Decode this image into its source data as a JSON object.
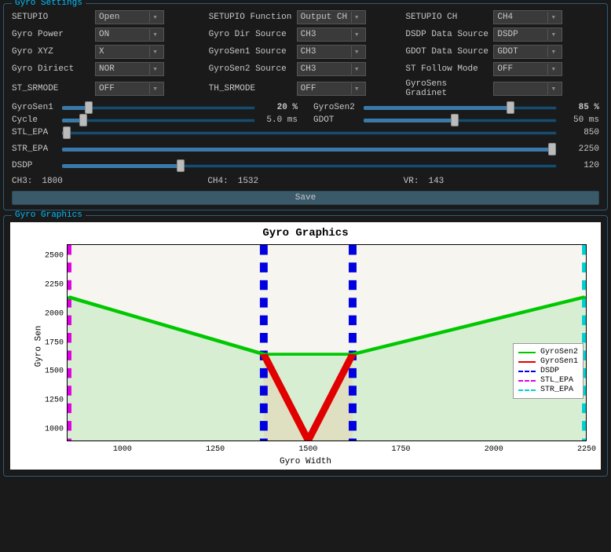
{
  "settings": {
    "title": "Gyro Settings",
    "rows": [
      {
        "l1": "SETUPIO",
        "v1": "Open",
        "l2": "SETUPIO Function",
        "v2": "Output CH",
        "l3": "SETUPIO CH",
        "v3": "CH4"
      },
      {
        "l1": "Gyro Power",
        "v1": "ON",
        "l2": "Gyro Dir Source",
        "v2": "CH3",
        "l3": "DSDP Data Source",
        "v3": "DSDP"
      },
      {
        "l1": "Gyro XYZ",
        "v1": "X",
        "l2": "GyroSen1 Source",
        "v2": "CH3",
        "l3": "GDOT Data Source",
        "v3": "GDOT"
      },
      {
        "l1": "Gyro Diriect",
        "v1": "NOR",
        "l2": "GyroSen2 Source",
        "v2": "CH3",
        "l3": "ST Follow Mode",
        "v3": "OFF"
      },
      {
        "l1": "ST_SRMODE",
        "v1": "OFF",
        "l2": "TH_SRMODE",
        "v2": "OFF",
        "l3": "GyroSens Gradinet",
        "v3": ""
      }
    ],
    "sliders_pair": {
      "a": {
        "label": "GyroSen1",
        "value": "20 %",
        "pct": 14
      },
      "b": {
        "label": "GyroSen2",
        "value": "85 %",
        "pct": 76
      }
    },
    "sliders_pair2": {
      "a": {
        "label": "Cycle",
        "value": "5.0 ms",
        "pct": 11
      },
      "b": {
        "label": "GDOT",
        "value": "50 ms",
        "pct": 47
      }
    },
    "sliders_full": [
      {
        "label": "STL_EPA",
        "value": "850",
        "pct": 1
      },
      {
        "label": "STR_EPA",
        "value": "2250",
        "pct": 99
      },
      {
        "label": "DSDP",
        "value": "120",
        "pct": 24
      }
    ],
    "status": {
      "ch3_label": "CH3:",
      "ch3": "1800",
      "ch4_label": "CH4:",
      "ch4": "1532",
      "vr_label": "VR:",
      "vr": "143"
    },
    "save_label": "Save"
  },
  "graphics": {
    "title": "Gyro Graphics",
    "chart_title": "Gyro Graphics",
    "ylabel": "Gyro Sen",
    "xlabel": "Gyro Width",
    "legend": [
      "GyroSen2",
      "GyroSen1",
      "DSDP",
      "STL_EPA",
      "STR_EPA"
    ]
  },
  "chart_data": {
    "type": "line",
    "title": "Gyro Graphics",
    "xlabel": "Gyro Width",
    "ylabel": "Gyro Sen",
    "xlim": [
      850,
      2250
    ],
    "ylim": [
      900,
      2600
    ],
    "yticks": [
      1000,
      1250,
      1500,
      1750,
      2000,
      2250,
      2500
    ],
    "xticks": [
      1000,
      1250,
      1500,
      1750,
      2000,
      2250
    ],
    "series": [
      {
        "name": "GyroSen2",
        "type": "line",
        "color": "#00c800",
        "x": [
          850,
          1380,
          1620,
          2250
        ],
        "y": [
          2150,
          1650,
          1650,
          2150
        ]
      },
      {
        "name": "GyroSen1",
        "type": "line",
        "color": "#e00000",
        "x": [
          1380,
          1500,
          1620
        ],
        "y": [
          1650,
          900,
          1650
        ]
      },
      {
        "name": "DSDP",
        "type": "vline",
        "color": "#0000e0",
        "style": "dashed",
        "x": [
          1380,
          1620
        ]
      },
      {
        "name": "STL_EPA",
        "type": "vline",
        "color": "#e000e0",
        "style": "dashed",
        "x": [
          850
        ]
      },
      {
        "name": "STR_EPA",
        "type": "vline",
        "color": "#00d0d0",
        "style": "dashed",
        "x": [
          2250
        ]
      }
    ]
  }
}
